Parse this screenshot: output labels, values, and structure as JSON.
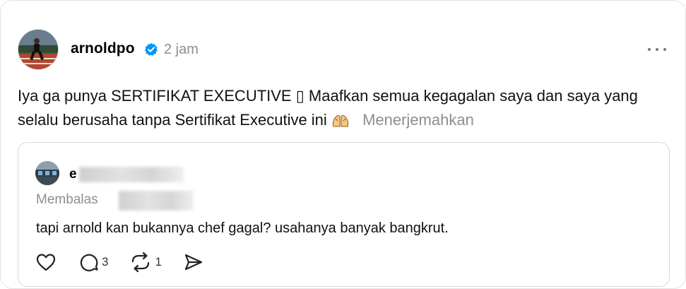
{
  "post": {
    "username": "arnoldpo",
    "time": "2 jam",
    "text": "Iya ga punya SERTIFIKAT EXECUTIVE ▯ Maafkan semua kegagalan saya dan saya yang selalu berusaha tanpa Sertifikat Executive ini",
    "translate_label": "Menerjemahkan",
    "verified_icon": "verified-badge-icon",
    "verified_color": "#0095f6"
  },
  "quote": {
    "username_visible": "e",
    "replying_label": "Membalas",
    "text": "tapi arnold kan bukannya chef gagal? usahanya banyak bangkrut.",
    "like_icon": "heart-icon",
    "comment_icon": "comment-icon",
    "comment_count": "3",
    "repost_icon": "repost-icon",
    "repost_count": "1",
    "share_icon": "send-icon"
  }
}
